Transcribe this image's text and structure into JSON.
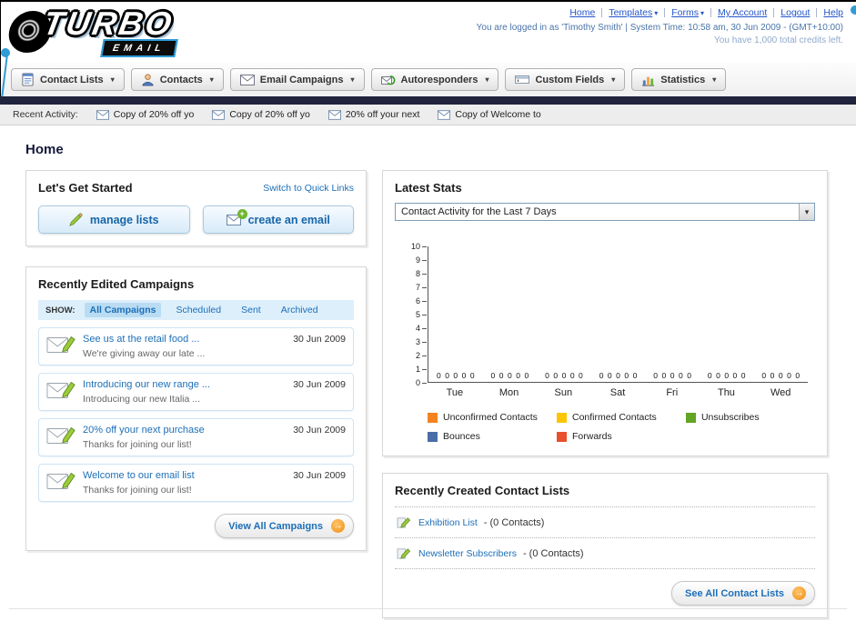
{
  "icons": {
    "dropdown": "▾",
    "arrow_right": "→",
    "plus": "+"
  },
  "header": {
    "logo": {
      "title": "TURBO",
      "subtitle": "EMAIL"
    },
    "top_links": [
      {
        "label": "Home"
      },
      {
        "label": "Templates",
        "dropdown": true
      },
      {
        "label": "Forms",
        "dropdown": true
      },
      {
        "label": "My Account"
      },
      {
        "label": "Logout"
      },
      {
        "label": "Help"
      }
    ],
    "login_info": "You are logged in as 'Timothy Smith' | System Time: 10:58 am, 30 Jun 2009 - (GMT+10:00)",
    "credits_info": "You have 1,000 total credits left."
  },
  "nav": {
    "tabs": [
      {
        "label": "Contact Lists",
        "icon": "contact-lists-icon"
      },
      {
        "label": "Contacts",
        "icon": "contacts-icon"
      },
      {
        "label": "Email Campaigns",
        "icon": "email-campaigns-icon"
      },
      {
        "label": "Autoresponders",
        "icon": "autoresponders-icon"
      },
      {
        "label": "Custom Fields",
        "icon": "custom-fields-icon"
      },
      {
        "label": "Statistics",
        "icon": "statistics-icon"
      }
    ]
  },
  "recent_activity": {
    "label": "Recent Activity:",
    "items": [
      {
        "label": "Copy of 20% off yo",
        "icon": "envelope-icon"
      },
      {
        "label": "Copy of 20% off yo",
        "icon": "envelope-icon"
      },
      {
        "label": "20% off your next",
        "icon": "envelope-icon"
      },
      {
        "label": "Copy of Welcome to",
        "icon": "envelope-icon"
      }
    ]
  },
  "page": {
    "title": "Home"
  },
  "getting_started": {
    "title": "Let's Get Started",
    "switch_link": "Switch to Quick Links",
    "manage_lists_label": "manage lists",
    "create_email_label": "create an email"
  },
  "campaigns": {
    "title": "Recently Edited Campaigns",
    "show_label": "SHOW:",
    "filters": [
      {
        "label": "All Campaigns",
        "active": true
      },
      {
        "label": "Scheduled"
      },
      {
        "label": "Sent"
      },
      {
        "label": "Archived"
      }
    ],
    "items": [
      {
        "title": "See us at the retail food ...",
        "subtitle": "We're giving away our late ...",
        "date": "30 Jun 2009"
      },
      {
        "title": "Introducing our new range ...",
        "subtitle": "Introducing our new Italia ...",
        "date": "30 Jun 2009"
      },
      {
        "title": "20% off your next purchase",
        "subtitle": "Thanks for joining our list!",
        "date": "30 Jun 2009"
      },
      {
        "title": "Welcome to our email list",
        "subtitle": "Thanks for joining our list!",
        "date": "30 Jun 2009"
      }
    ],
    "view_all_label": "View All Campaigns"
  },
  "stats": {
    "title": "Latest Stats",
    "selector_value": "Contact Activity for the Last 7 Days"
  },
  "chart_data": {
    "type": "bar",
    "title": "Contact Activity for the Last 7 Days",
    "categories": [
      "Tue",
      "Mon",
      "Sun",
      "Sat",
      "Fri",
      "Thu",
      "Wed"
    ],
    "series": [
      {
        "name": "Unconfirmed Contacts",
        "color": "#f58220",
        "values": [
          0,
          0,
          0,
          0,
          0,
          0,
          0
        ]
      },
      {
        "name": "Confirmed Contacts",
        "color": "#fdc500",
        "values": [
          0,
          0,
          0,
          0,
          0,
          0,
          0
        ]
      },
      {
        "name": "Unsubscribes",
        "color": "#61a523",
        "values": [
          0,
          0,
          0,
          0,
          0,
          0,
          0
        ]
      },
      {
        "name": "Bounces",
        "color": "#4a6da7",
        "values": [
          0,
          0,
          0,
          0,
          0,
          0,
          0
        ]
      },
      {
        "name": "Forwards",
        "color": "#e8502e",
        "values": [
          0,
          0,
          0,
          0,
          0,
          0,
          0
        ]
      }
    ],
    "ylim": [
      0,
      10
    ],
    "ytick_step": 1,
    "grid": false,
    "legend_position": "bottom",
    "value_labels_shown": true
  },
  "contact_lists": {
    "title": "Recently Created Contact Lists",
    "items": [
      {
        "name": "Exhibition List",
        "suffix": "- (0 Contacts)"
      },
      {
        "name": "Newsletter Subscribers",
        "suffix": "- (0 Contacts)"
      }
    ],
    "see_all_label": "See All Contact Lists"
  }
}
